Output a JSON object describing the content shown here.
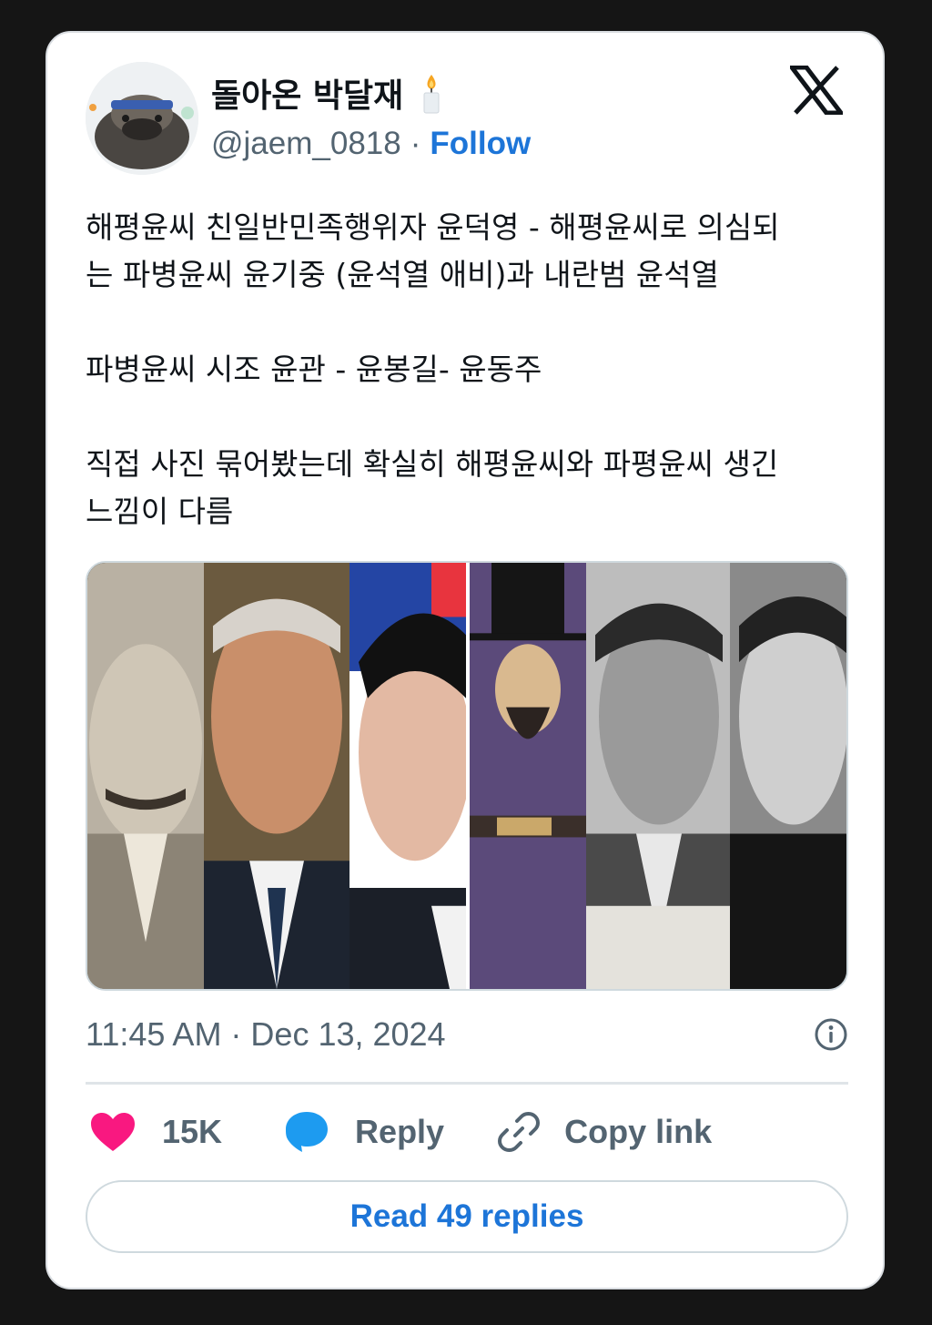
{
  "author": {
    "display_name": "돌아온 박달재",
    "handle": "@jaem_0818",
    "separator": "·",
    "follow_label": "Follow",
    "emoji_icon": "candle-icon"
  },
  "tweet": {
    "lines": [
      "해평윤씨 친일반민족행위자 윤덕영 - 해평윤씨로 의심되",
      "는 파병윤씨 윤기중 (윤석열 애비)과 내란범 윤석열",
      "파병윤씨 시조 윤관 - 윤봉길- 윤동주",
      "직접 사진 묶어봤는데 확실히 해평윤씨와 파평윤씨 생긴",
      "느낌이 다름"
    ]
  },
  "media": {
    "portraits": [
      "portrait-1",
      "portrait-2",
      "portrait-3",
      "portrait-4",
      "portrait-5",
      "portrait-6"
    ]
  },
  "meta": {
    "timestamp": "11:45 AM · Dec 13, 2024"
  },
  "actions": {
    "like_count": "15K",
    "reply_label": "Reply",
    "copy_link_label": "Copy link"
  },
  "footer": {
    "read_replies_label": "Read 49 replies"
  },
  "colors": {
    "accent": "#1d75d8",
    "like": "#f91880",
    "reply": "#1d9bf0",
    "muted": "#536471",
    "text": "#0f1419"
  }
}
